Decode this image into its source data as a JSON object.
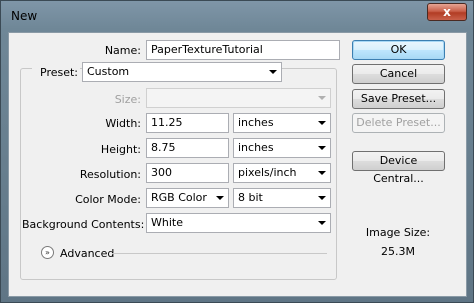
{
  "window": {
    "title": "New",
    "close_glyph": "x"
  },
  "form": {
    "name_label": "Name:",
    "name_value": "PaperTextureTutorial",
    "preset_label": "Preset:",
    "preset_value": "Custom",
    "size_label": "Size:",
    "size_value": "",
    "width_label": "Width:",
    "width_value": "11.25",
    "width_unit": "inches",
    "height_label": "Height:",
    "height_value": "8.75",
    "height_unit": "inches",
    "resolution_label": "Resolution:",
    "resolution_value": "300",
    "resolution_unit": "pixels/inch",
    "color_mode_label": "Color Mode:",
    "color_mode_value": "RGB Color",
    "bit_depth_value": "8 bit",
    "background_label": "Background Contents:",
    "background_value": "White",
    "advanced_label": "Advanced"
  },
  "buttons": {
    "ok": "OK",
    "cancel": "Cancel",
    "save_preset": "Save Preset...",
    "delete_preset": "Delete Preset...",
    "device_central": "Device Central..."
  },
  "image_size": {
    "label": "Image Size:",
    "value": "25.3M"
  },
  "icons": {
    "close": "close-icon",
    "advanced": "expand-chevron-icon"
  }
}
